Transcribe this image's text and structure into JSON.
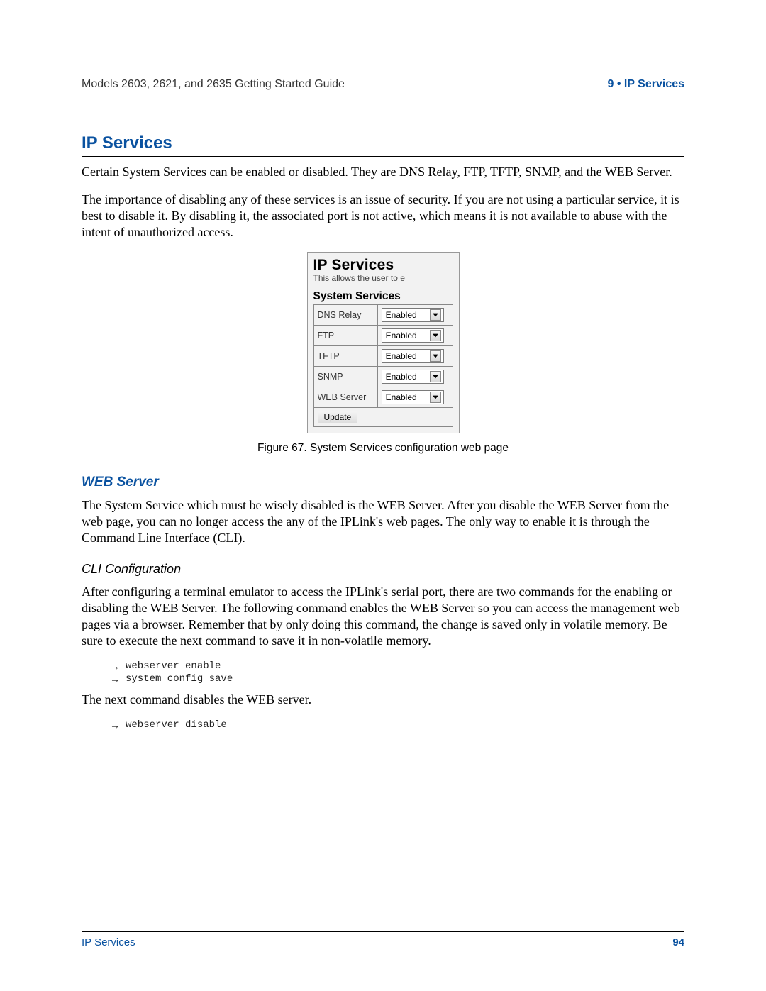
{
  "header": {
    "left": "Models 2603, 2621, and 2635 Getting Started Guide",
    "right": "9 • IP Services"
  },
  "section": {
    "title": "IP Services",
    "para1": "Certain System Services can be enabled or disabled. They are DNS Relay, FTP, TFTP, SNMP, and the WEB Server.",
    "para2": "The importance of disabling any of these services is an issue of security. If you are not using a particular service, it is best to disable it. By disabling it, the associated port is not active, which means it is not available to abuse with the intent of unauthorized access."
  },
  "figure": {
    "title": "IP Services",
    "tagline": "This allows the user to e",
    "subheader": "System Services",
    "services": [
      {
        "name": "DNS Relay",
        "value": "Enabled"
      },
      {
        "name": "FTP",
        "value": "Enabled"
      },
      {
        "name": "TFTP",
        "value": "Enabled"
      },
      {
        "name": "SNMP",
        "value": "Enabled"
      },
      {
        "name": "WEB Server",
        "value": "Enabled"
      }
    ],
    "update": "Update",
    "caption": "Figure 67. System Services configuration web page"
  },
  "web": {
    "title": "WEB Server",
    "para": "The System Service which must be wisely disabled is the WEB Server. After you disable the WEB Server from the web page, you can no longer access the any of the IPLink's web pages. The only way to enable it is through the Command Line Interface (CLI)."
  },
  "cli": {
    "title": "CLI Configuration",
    "para1": "After configuring a terminal emulator to access the IPLink's serial port, there are two commands for the enabling or disabling the WEB Server. The following command enables the WEB Server so you can access the management web pages via a browser. Remember that by only doing this command, the change is saved only in volatile memory. Be sure to execute the next command to save it in non-volatile memory.",
    "cmds1": [
      "webserver enable",
      "system config save"
    ],
    "para2": "The next command disables the WEB server.",
    "cmds2": [
      "webserver disable"
    ]
  },
  "footer": {
    "left": "IP Services",
    "page": "94"
  }
}
